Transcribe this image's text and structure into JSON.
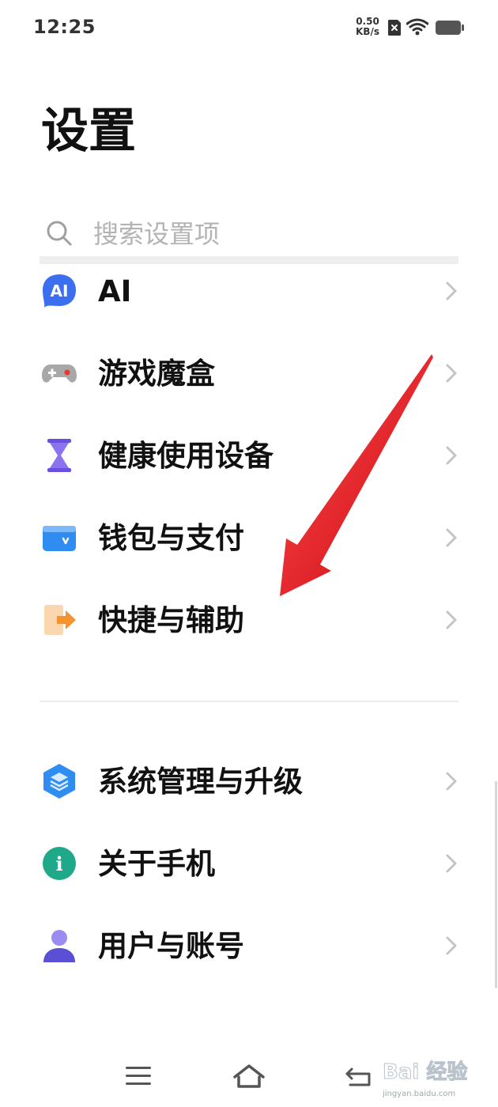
{
  "status_bar": {
    "time": "12:25",
    "net_speed_value": "0.50",
    "net_speed_unit": "KB/s",
    "icons": [
      "sim-disabled-icon",
      "wifi-icon",
      "battery-icon"
    ]
  },
  "page": {
    "title": "设置"
  },
  "search": {
    "placeholder": "搜索设置项"
  },
  "settings": {
    "group1": [
      {
        "label": "AI",
        "icon": "ai-icon",
        "icon_text": "AI",
        "icon_color": "#3b6ff0"
      },
      {
        "label": "游戏魔盒",
        "icon": "gamepad-icon",
        "icon_color": "#8c8c8c"
      },
      {
        "label": "健康使用设备",
        "icon": "hourglass-icon",
        "icon_color": "#6b4fe0"
      },
      {
        "label": "钱包与支付",
        "icon": "wallet-icon",
        "icon_color": "#2f8cf0"
      },
      {
        "label": "快捷与辅助",
        "icon": "shortcut-icon",
        "icon_color": "#f5a24a"
      }
    ],
    "group2": [
      {
        "label": "系统管理与升级",
        "icon": "system-layers-icon",
        "icon_color": "#2f8cf0"
      },
      {
        "label": "关于手机",
        "icon": "info-icon",
        "icon_text": "i",
        "icon_color": "#20a88a"
      },
      {
        "label": "用户与账号",
        "icon": "user-icon",
        "icon_color": "#6a5fe0"
      }
    ]
  },
  "nav": {
    "items": [
      "menu-icon",
      "home-icon",
      "back-icon"
    ]
  },
  "watermark": {
    "text": "Bai 经验",
    "domain": "jingyan.baidu.com"
  },
  "colors": {
    "annotation_arrow": "#e8141e",
    "chevron": "#c4c4c4"
  }
}
